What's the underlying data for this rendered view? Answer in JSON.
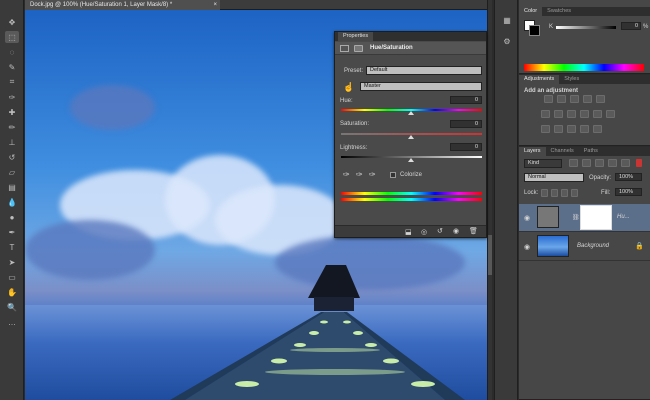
{
  "document": {
    "tab_title": "Dock.jpg @ 100% (Hue/Saturation 1, Layer Mask/8) *",
    "close_glyph": "×"
  },
  "toolbar": {
    "tools": [
      {
        "name": "move-tool-icon",
        "glyph": "✥"
      },
      {
        "name": "marquee-tool-icon",
        "glyph": "⬚"
      },
      {
        "name": "lasso-tool-icon",
        "glyph": "◌"
      },
      {
        "name": "quick-select-tool-icon",
        "glyph": "✎"
      },
      {
        "name": "crop-tool-icon",
        "glyph": "⌗"
      },
      {
        "name": "eyedropper-tool-icon",
        "glyph": "✑"
      },
      {
        "name": "healing-tool-icon",
        "glyph": "✚"
      },
      {
        "name": "brush-tool-icon",
        "glyph": "✏"
      },
      {
        "name": "stamp-tool-icon",
        "glyph": "⊥"
      },
      {
        "name": "history-brush-tool-icon",
        "glyph": "↺"
      },
      {
        "name": "eraser-tool-icon",
        "glyph": "▱"
      },
      {
        "name": "gradient-tool-icon",
        "glyph": "▤"
      },
      {
        "name": "blur-tool-icon",
        "glyph": "💧"
      },
      {
        "name": "dodge-tool-icon",
        "glyph": "●"
      },
      {
        "name": "pen-tool-icon",
        "glyph": "✒"
      },
      {
        "name": "type-tool-icon",
        "glyph": "T"
      },
      {
        "name": "path-select-tool-icon",
        "glyph": "➤"
      },
      {
        "name": "shape-tool-icon",
        "glyph": "▭"
      },
      {
        "name": "hand-tool-icon",
        "glyph": "✋"
      },
      {
        "name": "zoom-tool-icon",
        "glyph": "🔍"
      },
      {
        "name": "more-tools-icon",
        "glyph": "…"
      }
    ]
  },
  "color_panel": {
    "tabs": [
      "Color",
      "Swatches"
    ],
    "k_label": "K",
    "k_value": "0",
    "percent": "%"
  },
  "adjustments_panel": {
    "tabs": [
      "Adjustments",
      "Styles"
    ],
    "heading": "Add an adjustment"
  },
  "properties_panel": {
    "tab": "Properties",
    "title": "Hue/Saturation",
    "preset_label": "Preset:",
    "preset_value": "Default",
    "channel_value": "Master",
    "hue_label": "Hue:",
    "hue_value": "0",
    "saturation_label": "Saturation:",
    "saturation_value": "0",
    "lightness_label": "Lightness:",
    "lightness_value": "0",
    "colorize_label": "Colorize"
  },
  "layers_panel": {
    "tabs": [
      "Layers",
      "Channels",
      "Paths"
    ],
    "filter_kind": "Kind",
    "blend_mode": "Normal",
    "opacity_label": "Opacity:",
    "opacity_value": "100%",
    "lock_label": "Lock:",
    "fill_label": "Fill:",
    "fill_value": "100%",
    "layers": [
      {
        "name": "Hu..."
      },
      {
        "name": "Background"
      }
    ]
  },
  "colors": {
    "accent": "#3c78c8",
    "panel_bg": "#474747",
    "toolbar_bg": "#3a3a3a"
  }
}
